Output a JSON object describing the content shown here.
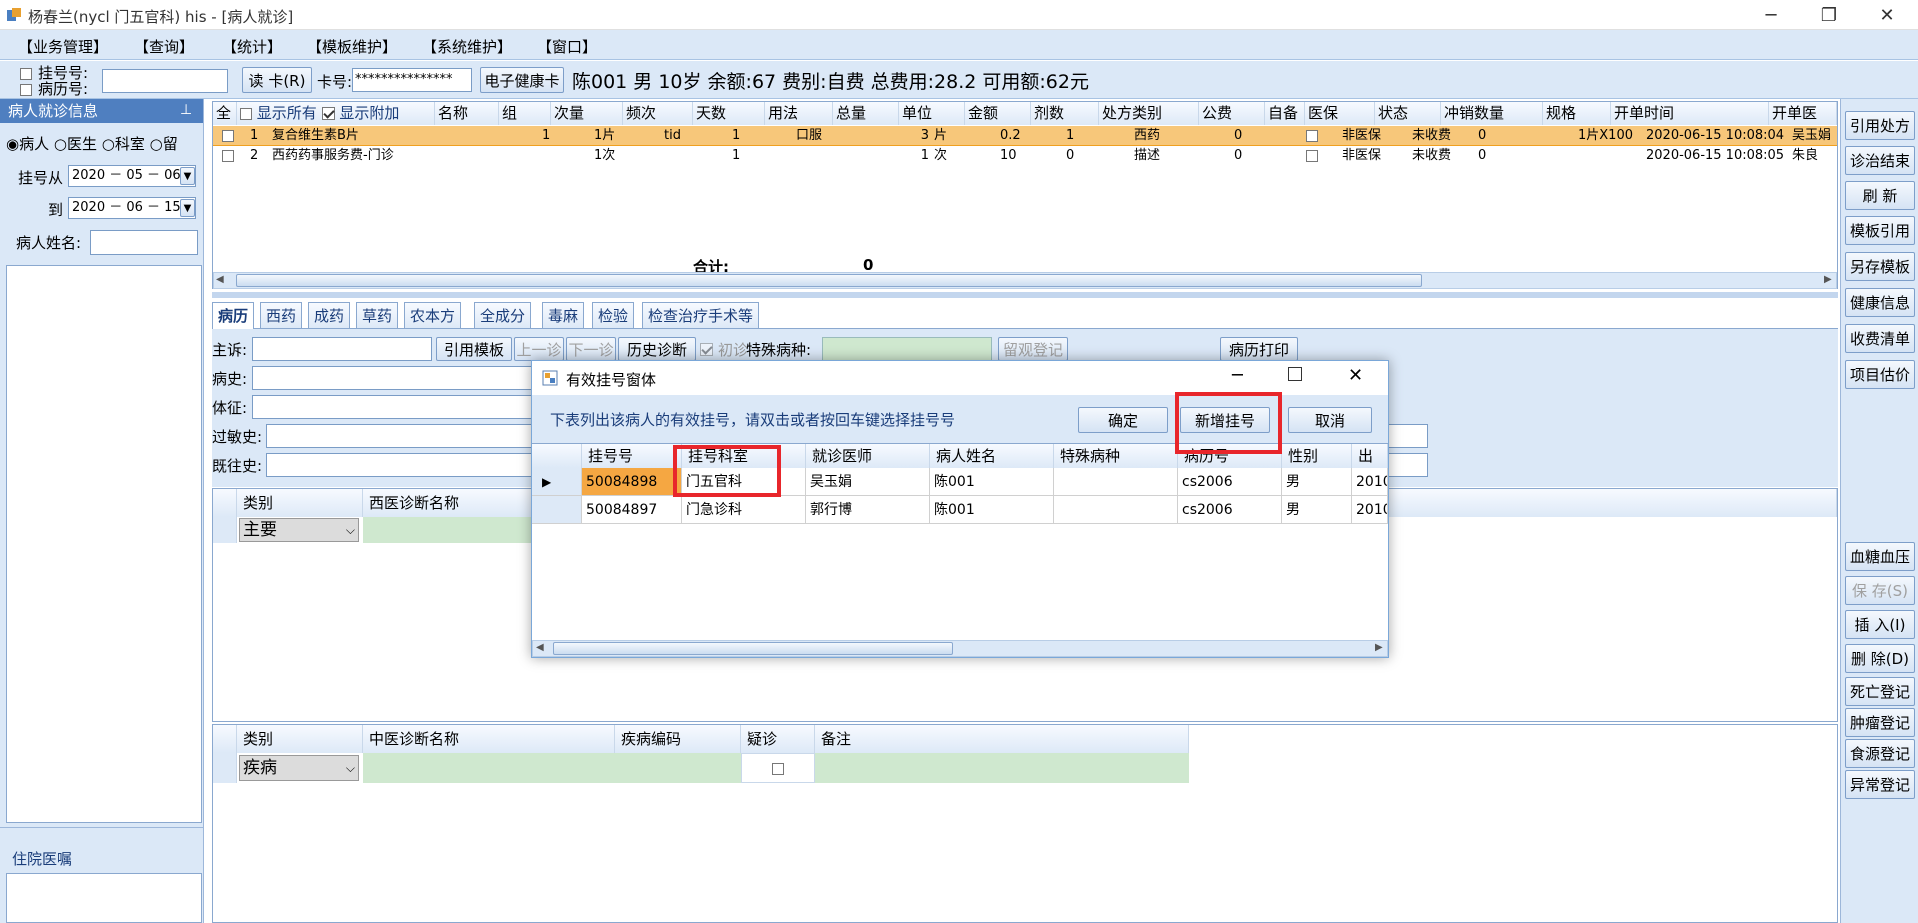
{
  "window": {
    "title": "杨春兰(nycl 门五官科) his - [病人就诊]"
  },
  "menu": [
    "【业务管理】",
    "【查询】",
    "【统计】",
    "【模板维护】",
    "【系统维护】",
    "【窗口】"
  ],
  "toolbar": {
    "reg_no_label": "挂号号:",
    "record_no_label": "病历号:",
    "read_card_label": "读 卡(R)",
    "card_no_label": "卡号:",
    "card_no_value": "***************",
    "ehealth_card_label": "电子健康卡",
    "patient_info": "陈001 男 10岁 余额:67 费别:自费 总费用:28.2 可用额:62元"
  },
  "left": {
    "header": "病人就诊信息",
    "radio_patient": "病人",
    "radio_doctor": "医生",
    "radio_dept": "科室",
    "radio_stay": "留",
    "reg_from_label": "挂号从",
    "reg_from_value": "2020 － 05 － 06",
    "reg_to_label": "到",
    "reg_to_value": "2020 － 06 － 15",
    "patient_name_label": "病人姓名:",
    "inpatient_orders": "住院医嘱"
  },
  "grid1": {
    "show_all": "显示所有",
    "show_extra": "显示附加",
    "headers": [
      "全",
      "",
      "",
      "名称",
      "组",
      "次量",
      "频次",
      "天数",
      "用法",
      "总量",
      "单位",
      "金额",
      "剂数",
      "处方类别",
      "公费",
      "自备",
      "医保",
      "状态",
      "冲销数量",
      "规格",
      "开单时间",
      "开单医"
    ],
    "rows": [
      {
        "no": "1",
        "name": "复合维生素B片",
        "group": "1",
        "dose": "1片",
        "freq": "tid",
        "days": "1",
        "usage": "口服",
        "total": "3",
        "unit": "片",
        "amount": "0.2",
        "qty": "1",
        "rx_type": "西药",
        "public": "0",
        "insurance": "非医保",
        "status": "未收费",
        "writeoff": "0",
        "spec": "1片X100",
        "time": "2020-06-15 10:08:04",
        "doctor": "吴玉娟"
      },
      {
        "no": "2",
        "name": "西药药事服务费-门诊",
        "group": "",
        "dose": "1次",
        "freq": "",
        "days": "1",
        "usage": "",
        "total": "1",
        "unit": "次",
        "amount": "10",
        "qty": "0",
        "rx_type": "描述",
        "public": "0",
        "insurance": "非医保",
        "status": "未收费",
        "writeoff": "0",
        "spec": "",
        "time": "2020-06-15 10:08:05",
        "doctor": "朱良"
      }
    ],
    "total_label": "合计:",
    "total_value": "0"
  },
  "tabs": [
    "病历",
    "西药",
    "成药",
    "草药",
    "农本方",
    "全成分",
    "毒麻",
    "检验",
    "检查治疗手术等"
  ],
  "record": {
    "complaint": "主诉:",
    "use_template": "引用模板",
    "prev_visit": "上一诊",
    "next_visit": "下一诊",
    "history_diag": "历史诊断",
    "first_visit": "初诊",
    "special_disease": "特殊病种:",
    "observe_register": "留观登记",
    "print_record": "病历打印",
    "history": "病史:",
    "sign": "体征:",
    "allergy": "过敏史:",
    "past_history": "既往史:"
  },
  "west_diag": {
    "col_type": "类别",
    "col_name": "西医诊断名称",
    "type_value": "主要"
  },
  "tcm_diag": {
    "col_type": "类别",
    "col_name": "中医诊断名称",
    "col_code": "疾病编码",
    "col_suspect": "疑诊",
    "col_note": "备注",
    "type_value": "疾病"
  },
  "rightbar": [
    "引用处方",
    "诊治结束",
    "刷 新",
    "模板引用",
    "另存模板",
    "健康信息",
    "收费清单",
    "项目估价",
    "血糖血压",
    "保 存(S)",
    "插 入(I)",
    "删 除(D)",
    "死亡登记",
    "肿瘤登记",
    "食源登记",
    "异常登记"
  ],
  "dialog": {
    "title": "有效挂号窗体",
    "hint": "下表列出该病人的有效挂号，请双击或者按回车键选择挂号号",
    "ok": "确定",
    "new_reg": "新增挂号",
    "cancel": "取消",
    "headers": [
      "挂号号",
      "挂号科室",
      "就诊医师",
      "病人姓名",
      "特殊病种",
      "病历号",
      "性别",
      "出生"
    ],
    "rows": [
      {
        "reg": "50084898",
        "dept": "门五官科",
        "doctor": "吴玉娟",
        "name": "陈001",
        "special": "",
        "record": "cs2006",
        "sex": "男",
        "birth": "2010"
      },
      {
        "reg": "50084897",
        "dept": "门急诊科",
        "doctor": "郭行博",
        "name": "陈001",
        "special": "",
        "record": "cs2006",
        "sex": "男",
        "birth": "2010"
      }
    ]
  },
  "colors": {
    "accent": "#dbe8f7",
    "highlight_row": "#f7c77a",
    "highlight_cell": "#f5a742",
    "red_box": "#e8262b"
  }
}
